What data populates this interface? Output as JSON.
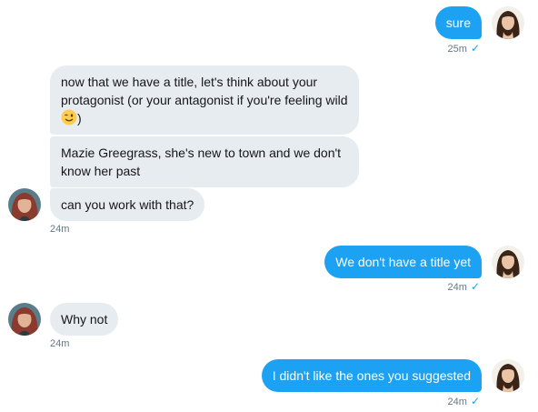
{
  "conversation": {
    "messages": [
      {
        "text": "sure",
        "timestamp": "25m",
        "read": "✓"
      },
      {
        "text_before": "now that we have a title, let's think about your protagonist (or your antagonist if you're feeling wild ",
        "emoji": "winking-face",
        "text_after": ")"
      },
      {
        "text": "Mazie Greegrass, she's new to town and we don't know her past"
      },
      {
        "text": "can you work with that?",
        "timestamp": "24m"
      },
      {
        "text": "We don't have a title yet",
        "timestamp": "24m",
        "read": "✓"
      },
      {
        "text": "Why not",
        "timestamp": "24m"
      },
      {
        "text": "I didn't like the ones you suggested",
        "timestamp": "24m",
        "read": "✓"
      }
    ]
  },
  "colors": {
    "sent_bubble": "#1da1f2",
    "received_bubble": "#e6ecf0",
    "meta_text": "#657786",
    "check": "#1da1f2"
  },
  "icons": {
    "read_receipt": "check-icon",
    "emoji": "winking-face-emoji"
  }
}
